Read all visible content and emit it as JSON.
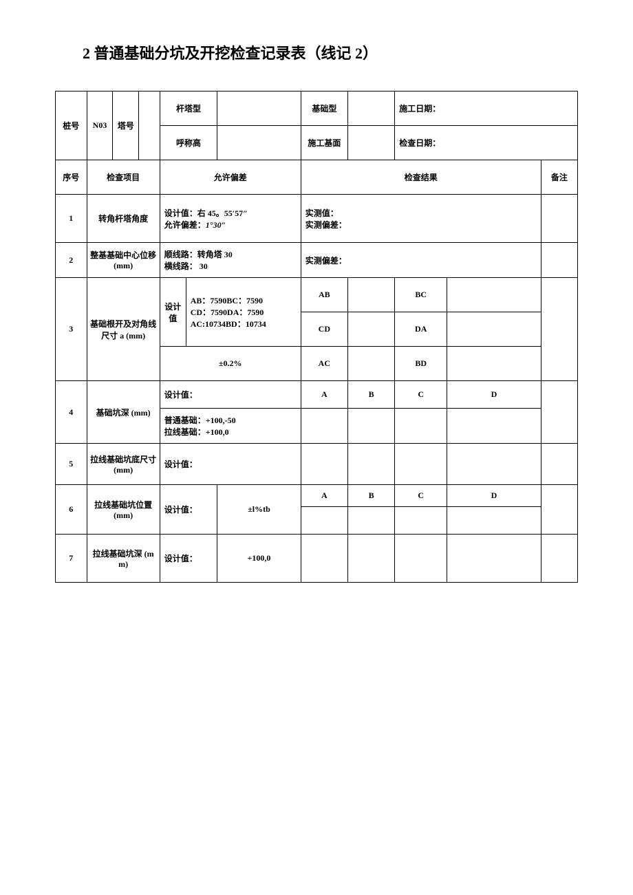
{
  "title": "2 普通基础分坑及开挖检查记录表（线记 2）",
  "header": {
    "pileNoLabel": "桩号",
    "pileNoValue": "N03",
    "towerNoLabel": "塔号",
    "towerTypeLabel": "杆塔型",
    "nominalHeightLabel": "呼称高",
    "foundationTypeLabel": "基础型",
    "constructionSurfaceLabel": "施工基面",
    "constructionDateLabel": "施工日期：",
    "inspectionDateLabel": "检查日期："
  },
  "cols": {
    "seq": "序号",
    "item": "检查项目",
    "tolerance": "允许偏差",
    "result": "检查结果",
    "remark": "备注"
  },
  "rows": {
    "r1": {
      "seq": "1",
      "item": "转角杆塔角度",
      "tolerance_l1": "设计值：右 45。55′57″",
      "tolerance_l2_a": "允许偏差：",
      "tolerance_l2_b": "1°30″",
      "result_l1": "实测值：",
      "result_l2": "实测偏差："
    },
    "r2": {
      "seq": "2",
      "item": "整基基础中心位移(mm)",
      "tolerance_l1": "顺线路：转角塔 30",
      "tolerance_l2": "横线路： 30",
      "result": "实测偏差："
    },
    "r3": {
      "seq": "3",
      "item": "基础根开及对角线尺寸 a (mm)",
      "design_label": "设计值",
      "design_l1": "AB：7590BC：7590",
      "design_l2": "CD：7590DA：7590",
      "design_l3": "AC:10734BD：10734",
      "tolerance": "±0.2%",
      "ab": "AB",
      "bc": "BC",
      "cd": "CD",
      "da": "DA",
      "ac": "AC",
      "bd": "BD"
    },
    "r4": {
      "seq": "4",
      "item": "基础坑深 (mm)",
      "design": "设计值：",
      "tolerance_l1": "普通基础：+100,-50",
      "tolerance_l2": "拉线基础：+100,0",
      "a": "A",
      "b": "B",
      "c": "C",
      "d": "D"
    },
    "r5": {
      "seq": "5",
      "item": "拉线基础坑底尺寸(mm)",
      "design": "设计值："
    },
    "r6": {
      "seq": "6",
      "item": "拉线基础坑位置 (mm)",
      "design": "设计值：",
      "tolerance": "±l%tb",
      "a": "A",
      "b": "B",
      "c": "C",
      "d": "D"
    },
    "r7": {
      "seq": "7",
      "item": "拉线基础坑深 (mm)",
      "design": "设计值：",
      "tolerance": "+100,0"
    }
  }
}
